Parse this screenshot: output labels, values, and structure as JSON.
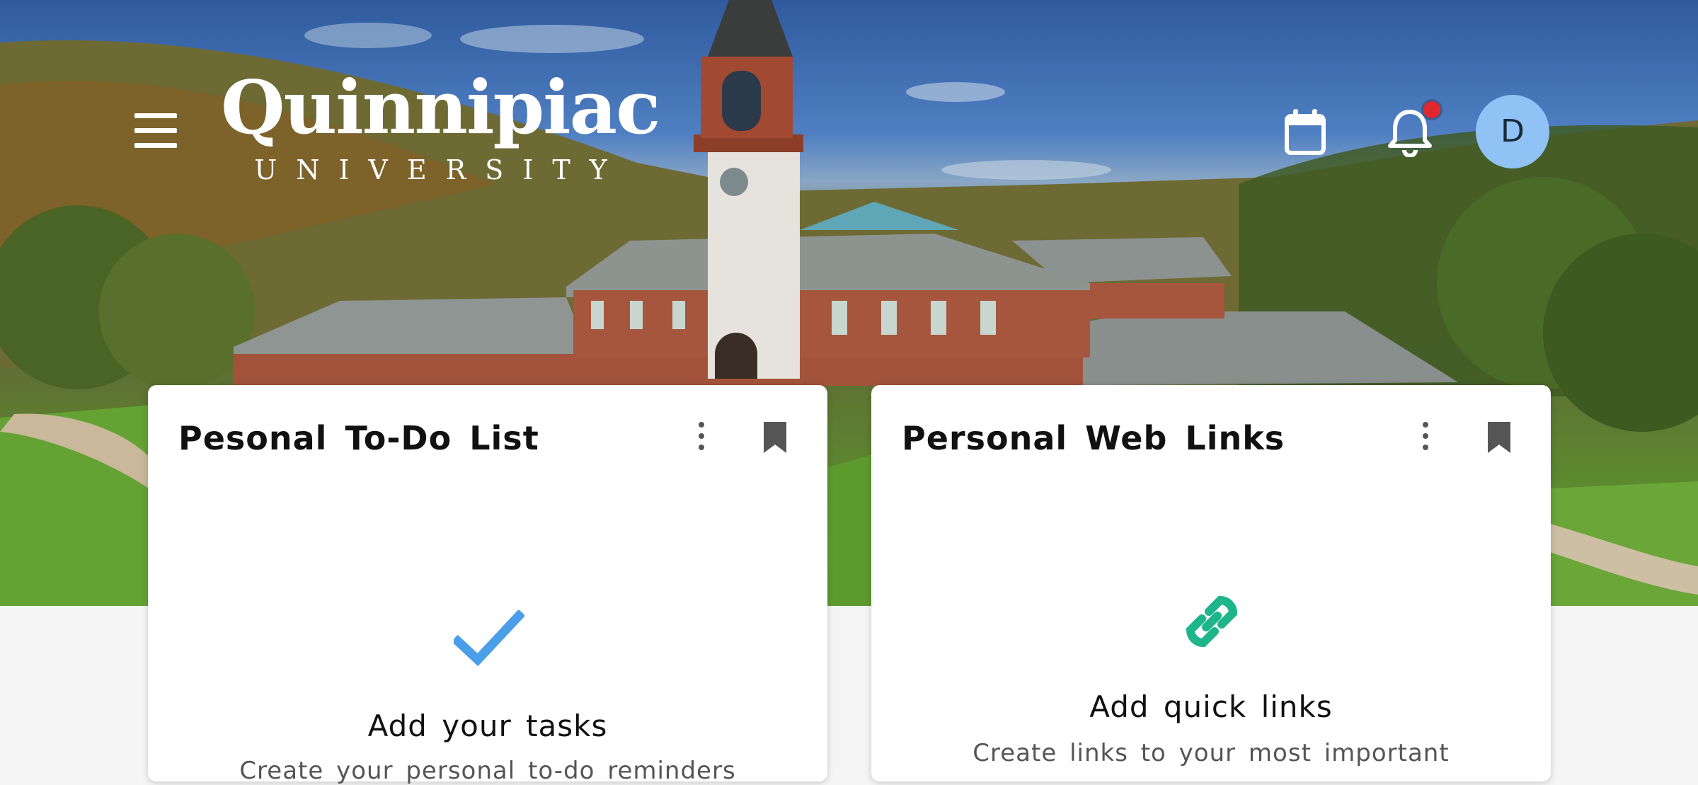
{
  "header": {
    "logo": {
      "wordmark": "Quinnipiac",
      "sub": "UNIVERSITY"
    },
    "icons": {
      "menu": "menu-icon",
      "calendar": "calendar-icon",
      "notifications": "bell-icon"
    },
    "avatar_initial": "D",
    "notification_dot_color": "#e0262f",
    "avatar_color": "#90c2f6"
  },
  "cards": {
    "todo": {
      "title": "Pesonal To-Do List",
      "icon": "check-icon",
      "heading": "Add your tasks",
      "description": "Create your personal to-do reminders"
    },
    "links": {
      "title": "Personal Web Links",
      "icon": "link-icon",
      "heading": "Add quick links",
      "description": "Create links to your most important"
    }
  },
  "colors": {
    "check": "#4a9fe8",
    "link": "#1fb58a",
    "card_bg": "#ffffff",
    "page_bg": "#f5f5f5"
  }
}
